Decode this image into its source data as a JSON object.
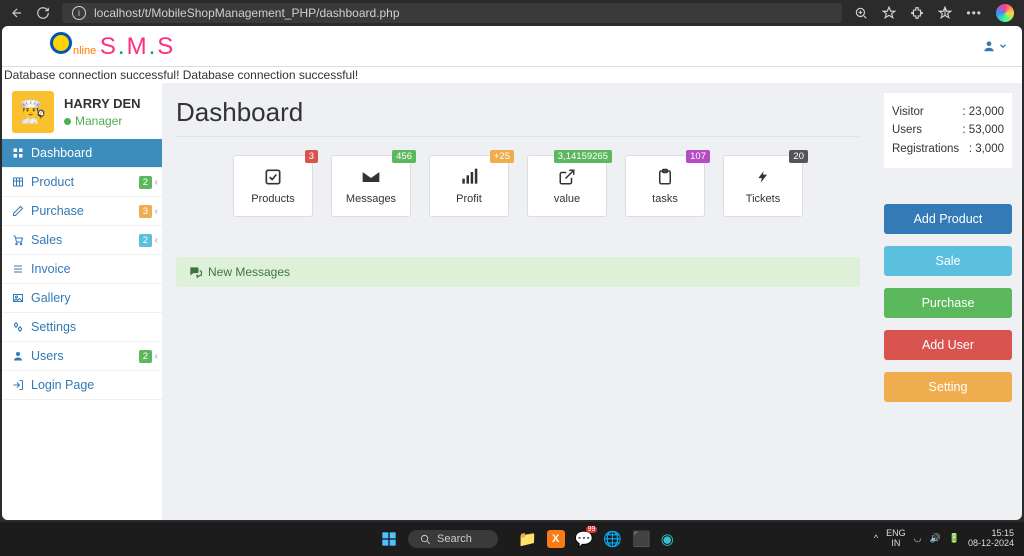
{
  "browser": {
    "url": "localhost/t/MobileShopManagement_PHP/dashboard.php"
  },
  "logo": {
    "part1": "nline",
    "part2a": "S",
    "dot": ".",
    "part2b": "M",
    "part2c": "S"
  },
  "status": "Database connection successful! Database connection successful!",
  "profile": {
    "name": "HARRY DEN",
    "role": "Manager"
  },
  "nav": {
    "dashboard": "Dashboard",
    "product": "Product",
    "product_badge": "2",
    "purchase": "Purchase",
    "purchase_badge": "3",
    "sales": "Sales",
    "sales_badge": "2",
    "invoice": "Invoice",
    "gallery": "Gallery",
    "settings": "Settings",
    "users": "Users",
    "users_badge": "2",
    "login": "Login Page"
  },
  "page": {
    "title": "Dashboard"
  },
  "stats": {
    "products": {
      "label": "Products",
      "badge": "3"
    },
    "messages": {
      "label": "Messages",
      "badge": "456"
    },
    "profit": {
      "label": "Profit",
      "badge": "+25"
    },
    "value": {
      "label": "value",
      "badge": "3,14159265"
    },
    "tasks": {
      "label": "tasks",
      "badge": "107"
    },
    "tickets": {
      "label": "Tickets",
      "badge": "20"
    }
  },
  "messages_panel": {
    "title": "New Messages"
  },
  "summary": {
    "visitor_l": "Visitor",
    "visitor_v": ": 23,000",
    "users_l": "Users",
    "users_v": ": 53,000",
    "reg_l": "Registrations",
    "reg_v": ": 3,000"
  },
  "actions": {
    "add_product": "Add Product",
    "sale": "Sale",
    "purchase": "Purchase",
    "add_user": "Add User",
    "setting": "Setting"
  },
  "taskbar": {
    "search": "Search",
    "lang1": "ENG",
    "lang2": "IN",
    "time": "15:15",
    "date": "08-12-2024"
  }
}
